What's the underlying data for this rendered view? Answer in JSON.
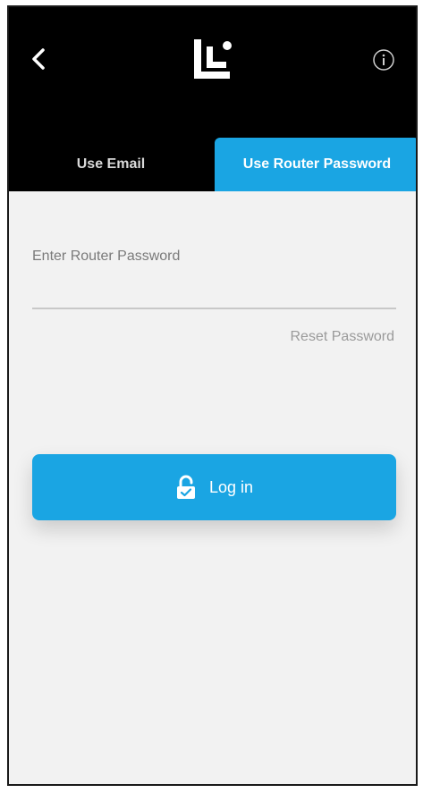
{
  "header": {
    "back_icon": "chevron-left-icon",
    "logo_icon": "linksys-logo-icon",
    "info_icon": "info-circle-icon"
  },
  "tabs": [
    {
      "label": "Use Email",
      "active": false
    },
    {
      "label": "Use Router Password",
      "active": true
    }
  ],
  "form": {
    "field_label": "Enter Router Password",
    "password_value": "",
    "reset_link": "Reset Password"
  },
  "login_button": {
    "label": "Log in",
    "icon": "unlock-icon"
  },
  "colors": {
    "accent": "#1aa5e3",
    "header_bg": "#000000",
    "body_bg": "#f2f2f2"
  }
}
